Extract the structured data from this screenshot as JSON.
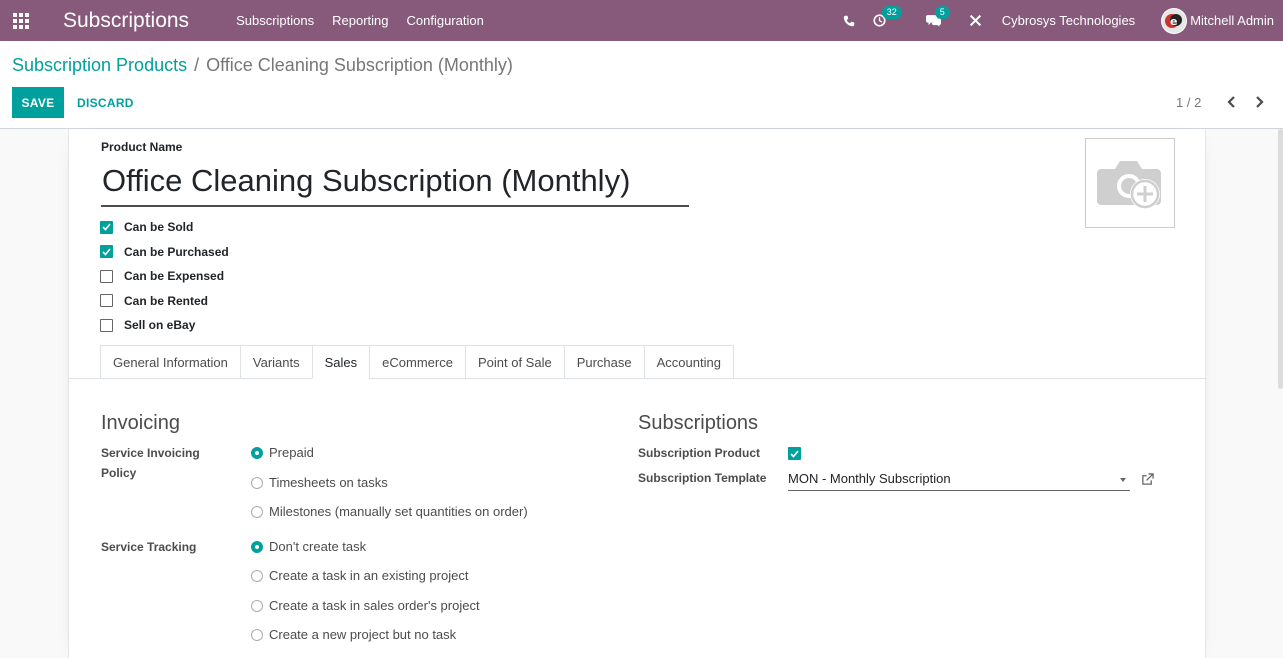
{
  "navbar": {
    "app_title": "Subscriptions",
    "menu": [
      "Subscriptions",
      "Reporting",
      "Configuration"
    ],
    "activity_count": "32",
    "messages_count": "5",
    "company": "Cybrosys Technologies",
    "user": "Mitchell Admin",
    "colors": {
      "bar": "#875a7b",
      "accent": "#00a09d"
    }
  },
  "control_panel": {
    "breadcrumb_parent": "Subscription Products",
    "breadcrumb_separator": "/",
    "breadcrumb_current": "Office Cleaning Subscription (Monthly)",
    "save_label": "SAVE",
    "discard_label": "DISCARD",
    "pager": "1 / 2"
  },
  "form": {
    "product_name_label": "Product Name",
    "product_name": "Office Cleaning Subscription (Monthly)",
    "checkboxes": [
      {
        "label": "Can be Sold",
        "checked": true
      },
      {
        "label": "Can be Purchased",
        "checked": true
      },
      {
        "label": "Can be Expensed",
        "checked": false
      },
      {
        "label": "Can be Rented",
        "checked": false
      },
      {
        "label": "Sell on eBay",
        "checked": false
      }
    ],
    "tabs": [
      "General Information",
      "Variants",
      "Sales",
      "eCommerce",
      "Point of Sale",
      "Purchase",
      "Accounting"
    ],
    "active_tab": "Sales",
    "invoicing": {
      "title": "Invoicing",
      "policy_label_line1": "Service Invoicing",
      "policy_label_line2": "Policy",
      "policy_options": [
        "Prepaid",
        "Timesheets on tasks",
        "Milestones (manually set quantities on order)"
      ],
      "policy_selected": "Prepaid",
      "tracking_label": "Service Tracking",
      "tracking_options": [
        "Don't create task",
        "Create a task in an existing project",
        "Create a task in sales order's project",
        "Create a new project but no task"
      ],
      "tracking_selected": "Don't create task"
    },
    "subscriptions": {
      "title": "Subscriptions",
      "product_label": "Subscription Product",
      "product_checked": true,
      "template_label": "Subscription Template",
      "template_value": "MON - Monthly Subscription"
    }
  }
}
